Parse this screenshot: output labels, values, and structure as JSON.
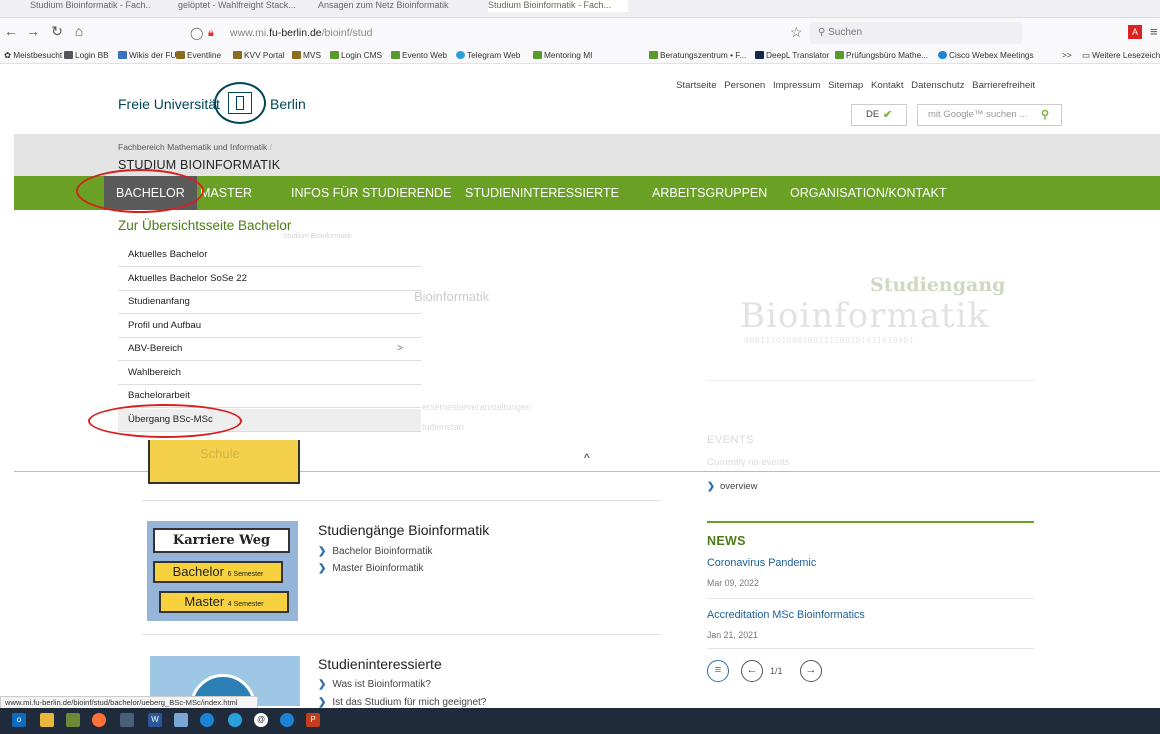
{
  "browser": {
    "tabs": [
      "Studium Bioinformatik - Fach...",
      "gelöptet - Wahlfreight Stack...",
      "Ansagen zum Netz Bioinformatik",
      "Studium Bioinformatik - Fach..."
    ],
    "url_prefix": "www.mi.",
    "url_domain": "fu-berlin.de",
    "url_path": "/bioinf/stud",
    "search_placeholder": "Suchen",
    "bookmarks": [
      "Meistbesucht",
      "Login BB",
      "Wikis der FU",
      "Eventline",
      "KVV Portal",
      "MVS",
      "Login CMS",
      "Evento Web",
      "Telegram Web",
      "Mentoring MI",
      "Beratungszentrum • F...",
      "DeepL Translator",
      "Prüfungsbüro Mathe...",
      "Cisco Webex Meetings",
      "Weitere Lesezeich"
    ],
    "bookmark_overflow": ">>"
  },
  "header": {
    "logo_left": "Freie Universität",
    "logo_right": "Berlin",
    "service_nav": [
      "Startseite",
      "Personen",
      "Impressum",
      "Sitemap",
      "Kontakt",
      "Datenschutz",
      "Barrierefreiheit"
    ],
    "lang": "DE",
    "search_placeholder": "mit Google™ suchen ..."
  },
  "breadcrumb": {
    "parent": "Fachbereich Mathematik und Informatik",
    "separator": "/",
    "title": "STUDIUM BIOINFORMATIK"
  },
  "mainnav": [
    "BACHELOR",
    "MASTER",
    "INFOS FÜR STUDIERENDE",
    "STUDIENINTERESSIERTE",
    "ARBEITSGRUPPEN",
    "ORGANISATION/KONTAKT"
  ],
  "dropdown": {
    "title": "Zur Übersichtsseite Bachelor",
    "items": [
      "Aktuelles Bachelor",
      "Aktuelles Bachelor SoSe 22",
      "Studienanfang",
      "Profil und Aufbau",
      "ABV-Bereich",
      "Wahlbereich",
      "Bachelorarbeit",
      "Übergang BSc-MSc"
    ],
    "submenu_arrow": ">",
    "close_caret": "^"
  },
  "faded": {
    "crumb": "Studium Bioinformatik",
    "heading_fragment": "Bioinformatik",
    "text1": "ersemesterveranstaltungen",
    "text2": "tudienstart",
    "logo_line1": "Studiengang",
    "logo_line2": "Bioinformatik",
    "logo_line3": "00011101000100111100101011010001"
  },
  "content": {
    "schule_label": "Schule",
    "karriere": {
      "sign1": "Karriere Weg",
      "sign2": "Bachelor",
      "sign2_small": "6 Semester",
      "sign3": "Master",
      "sign3_small": "4 Semester"
    },
    "studiengaenge": {
      "title": "Studiengänge Bioinformatik",
      "links": [
        "Bachelor Bioinformatik",
        "Master Bioinformatik"
      ]
    },
    "interessierte": {
      "title": "Studieninteressierte",
      "links": [
        "Was ist Bioinformatik?",
        "Ist das Studium für mich geeignet?"
      ]
    }
  },
  "sidebar": {
    "events_title": "EVENTS",
    "events_none": "Currently no events",
    "overview": "overview",
    "news_title": "NEWS",
    "news": [
      {
        "title": "Coronavirus Pandemic",
        "date": "Mar 09, 2022"
      },
      {
        "title": "Accreditation MSc Bioinformatics",
        "date": "Jan 21, 2021"
      }
    ],
    "pagination": "1/1"
  },
  "statusbar": "www.mi.fu-berlin.de/bioinf/stud/bachelor/ueberg_BSc-MSc/index.html",
  "colors": {
    "green": "#6aa125",
    "fu_blue": "#004659",
    "annotation_red": "#d62020"
  }
}
